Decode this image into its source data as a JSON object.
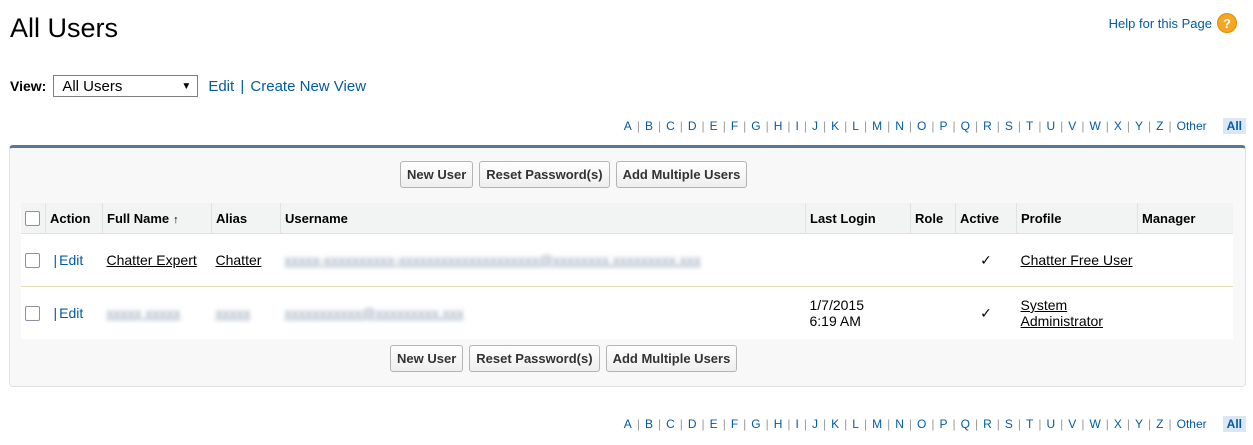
{
  "header": {
    "title": "All Users",
    "help_text": "Help for this Page",
    "help_icon": "?"
  },
  "view": {
    "label": "View:",
    "selected": "All Users",
    "edit_link": "Edit",
    "separator": "|",
    "create_link": "Create New View"
  },
  "alphabet": {
    "letters": [
      "A",
      "B",
      "C",
      "D",
      "E",
      "F",
      "G",
      "H",
      "I",
      "J",
      "K",
      "L",
      "M",
      "N",
      "O",
      "P",
      "Q",
      "R",
      "S",
      "T",
      "U",
      "V",
      "W",
      "X",
      "Y",
      "Z",
      "Other"
    ],
    "selected": "All"
  },
  "buttons": {
    "new_user": "New User",
    "reset_password": "Reset Password(s)",
    "add_multiple": "Add Multiple Users"
  },
  "table": {
    "headers": {
      "action": "Action",
      "full_name": "Full Name",
      "sort_indicator": "↑",
      "alias": "Alias",
      "username": "Username",
      "last_login": "Last Login",
      "role": "Role",
      "active": "Active",
      "profile": "Profile",
      "manager": "Manager"
    },
    "rows": [
      {
        "action": "Edit",
        "full_name": "Chatter Expert",
        "alias": "Chatter",
        "username": "xxxxx-xxxxxxxxxx-xxxxxxxxxxxxxxxxxxxx@xxxxxxxx.xxxxxxxxx.xxx",
        "last_login_date": "",
        "last_login_time": "",
        "role": "",
        "active": "✓",
        "profile": "Chatter Free User",
        "manager": ""
      },
      {
        "action": "Edit",
        "full_name": "xxxxx xxxxx",
        "alias": "xxxxx",
        "username": "xxxxxxxxxxx@xxxxxxxxx.xxx",
        "last_login_date": "1/7/2015",
        "last_login_time": "6:19 AM",
        "role": "",
        "active": "✓",
        "profile": "System Administrator",
        "manager": ""
      }
    ]
  }
}
